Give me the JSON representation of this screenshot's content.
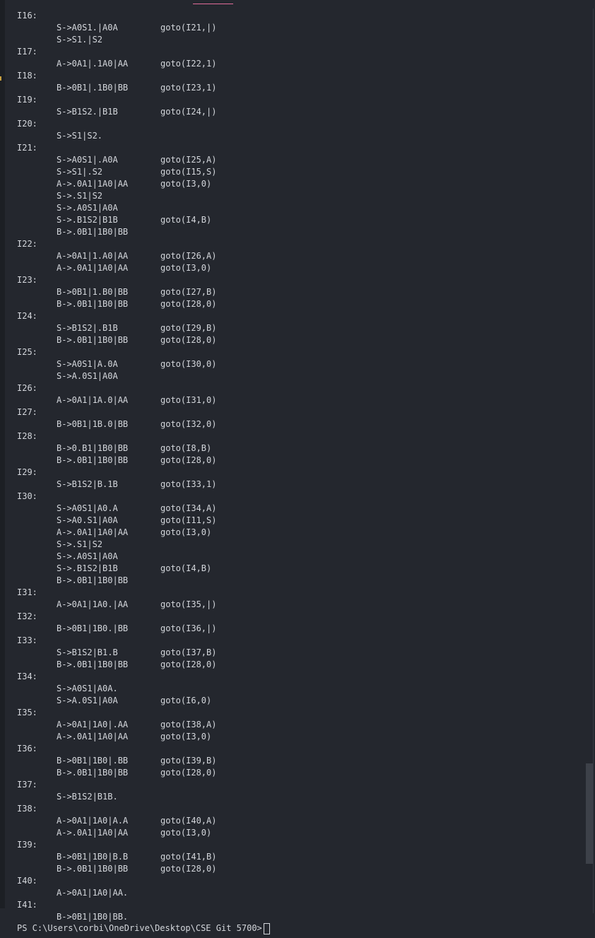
{
  "terminal": {
    "prompt": "PS C:\\Users\\corbi\\OneDrive\\Desktop\\CSE Git 5700>",
    "lines": [
      {
        "label": "I16:",
        "item": "",
        "goto": ""
      },
      {
        "label": "",
        "item": "S->A0S1.|A0A",
        "goto": "goto(I21,|)"
      },
      {
        "label": "",
        "item": "S->S1.|S2",
        "goto": ""
      },
      {
        "label": "I17:",
        "item": "",
        "goto": ""
      },
      {
        "label": "",
        "item": "A->0A1|.1A0|AA",
        "goto": "goto(I22,1)"
      },
      {
        "label": "I18:",
        "item": "",
        "goto": ""
      },
      {
        "label": "",
        "item": "B->0B1|.1B0|BB",
        "goto": "goto(I23,1)"
      },
      {
        "label": "I19:",
        "item": "",
        "goto": ""
      },
      {
        "label": "",
        "item": "S->B1S2.|B1B",
        "goto": "goto(I24,|)"
      },
      {
        "label": "I20:",
        "item": "",
        "goto": ""
      },
      {
        "label": "",
        "item": "S->S1|S2.",
        "goto": ""
      },
      {
        "label": "I21:",
        "item": "",
        "goto": ""
      },
      {
        "label": "",
        "item": "S->A0S1|.A0A",
        "goto": "goto(I25,A)"
      },
      {
        "label": "",
        "item": "S->S1|.S2",
        "goto": "goto(I15,S)"
      },
      {
        "label": "",
        "item": "A->.0A1|1A0|AA",
        "goto": "goto(I3,0)"
      },
      {
        "label": "",
        "item": "S->.S1|S2",
        "goto": ""
      },
      {
        "label": "",
        "item": "S->.A0S1|A0A",
        "goto": ""
      },
      {
        "label": "",
        "item": "S->.B1S2|B1B",
        "goto": "goto(I4,B)"
      },
      {
        "label": "",
        "item": "B->.0B1|1B0|BB",
        "goto": ""
      },
      {
        "label": "I22:",
        "item": "",
        "goto": ""
      },
      {
        "label": "",
        "item": "A->0A1|1.A0|AA",
        "goto": "goto(I26,A)"
      },
      {
        "label": "",
        "item": "A->.0A1|1A0|AA",
        "goto": "goto(I3,0)"
      },
      {
        "label": "I23:",
        "item": "",
        "goto": ""
      },
      {
        "label": "",
        "item": "B->0B1|1.B0|BB",
        "goto": "goto(I27,B)"
      },
      {
        "label": "",
        "item": "B->.0B1|1B0|BB",
        "goto": "goto(I28,0)"
      },
      {
        "label": "I24:",
        "item": "",
        "goto": ""
      },
      {
        "label": "",
        "item": "S->B1S2|.B1B",
        "goto": "goto(I29,B)"
      },
      {
        "label": "",
        "item": "B->.0B1|1B0|BB",
        "goto": "goto(I28,0)"
      },
      {
        "label": "I25:",
        "item": "",
        "goto": ""
      },
      {
        "label": "",
        "item": "S->A0S1|A.0A",
        "goto": "goto(I30,0)"
      },
      {
        "label": "",
        "item": "S->A.0S1|A0A",
        "goto": ""
      },
      {
        "label": "I26:",
        "item": "",
        "goto": ""
      },
      {
        "label": "",
        "item": "A->0A1|1A.0|AA",
        "goto": "goto(I31,0)"
      },
      {
        "label": "I27:",
        "item": "",
        "goto": ""
      },
      {
        "label": "",
        "item": "B->0B1|1B.0|BB",
        "goto": "goto(I32,0)"
      },
      {
        "label": "I28:",
        "item": "",
        "goto": ""
      },
      {
        "label": "",
        "item": "B->0.B1|1B0|BB",
        "goto": "goto(I8,B)"
      },
      {
        "label": "",
        "item": "B->.0B1|1B0|BB",
        "goto": "goto(I28,0)"
      },
      {
        "label": "I29:",
        "item": "",
        "goto": ""
      },
      {
        "label": "",
        "item": "S->B1S2|B.1B",
        "goto": "goto(I33,1)"
      },
      {
        "label": "I30:",
        "item": "",
        "goto": ""
      },
      {
        "label": "",
        "item": "S->A0S1|A0.A",
        "goto": "goto(I34,A)"
      },
      {
        "label": "",
        "item": "S->A0.S1|A0A",
        "goto": "goto(I11,S)"
      },
      {
        "label": "",
        "item": "A->.0A1|1A0|AA",
        "goto": "goto(I3,0)"
      },
      {
        "label": "",
        "item": "S->.S1|S2",
        "goto": ""
      },
      {
        "label": "",
        "item": "S->.A0S1|A0A",
        "goto": ""
      },
      {
        "label": "",
        "item": "S->.B1S2|B1B",
        "goto": "goto(I4,B)"
      },
      {
        "label": "",
        "item": "B->.0B1|1B0|BB",
        "goto": ""
      },
      {
        "label": "I31:",
        "item": "",
        "goto": ""
      },
      {
        "label": "",
        "item": "A->0A1|1A0.|AA",
        "goto": "goto(I35,|)"
      },
      {
        "label": "I32:",
        "item": "",
        "goto": ""
      },
      {
        "label": "",
        "item": "B->0B1|1B0.|BB",
        "goto": "goto(I36,|)"
      },
      {
        "label": "I33:",
        "item": "",
        "goto": ""
      },
      {
        "label": "",
        "item": "S->B1S2|B1.B",
        "goto": "goto(I37,B)"
      },
      {
        "label": "",
        "item": "B->.0B1|1B0|BB",
        "goto": "goto(I28,0)"
      },
      {
        "label": "I34:",
        "item": "",
        "goto": ""
      },
      {
        "label": "",
        "item": "S->A0S1|A0A.",
        "goto": ""
      },
      {
        "label": "",
        "item": "S->A.0S1|A0A",
        "goto": "goto(I6,0)"
      },
      {
        "label": "I35:",
        "item": "",
        "goto": ""
      },
      {
        "label": "",
        "item": "A->0A1|1A0|.AA",
        "goto": "goto(I38,A)"
      },
      {
        "label": "",
        "item": "A->.0A1|1A0|AA",
        "goto": "goto(I3,0)"
      },
      {
        "label": "I36:",
        "item": "",
        "goto": ""
      },
      {
        "label": "",
        "item": "B->0B1|1B0|.BB",
        "goto": "goto(I39,B)"
      },
      {
        "label": "",
        "item": "B->.0B1|1B0|BB",
        "goto": "goto(I28,0)"
      },
      {
        "label": "I37:",
        "item": "",
        "goto": ""
      },
      {
        "label": "",
        "item": "S->B1S2|B1B.",
        "goto": ""
      },
      {
        "label": "I38:",
        "item": "",
        "goto": ""
      },
      {
        "label": "",
        "item": "A->0A1|1A0|A.A",
        "goto": "goto(I40,A)"
      },
      {
        "label": "",
        "item": "A->.0A1|1A0|AA",
        "goto": "goto(I3,0)"
      },
      {
        "label": "I39:",
        "item": "",
        "goto": ""
      },
      {
        "label": "",
        "item": "B->0B1|1B0|B.B",
        "goto": "goto(I41,B)"
      },
      {
        "label": "",
        "item": "B->.0B1|1B0|BB",
        "goto": "goto(I28,0)"
      },
      {
        "label": "I40:",
        "item": "",
        "goto": ""
      },
      {
        "label": "",
        "item": "A->0A1|1A0|AA.",
        "goto": ""
      },
      {
        "label": "I41:",
        "item": "",
        "goto": ""
      },
      {
        "label": "",
        "item": "B->0B1|1B0|BB.",
        "goto": ""
      }
    ]
  }
}
